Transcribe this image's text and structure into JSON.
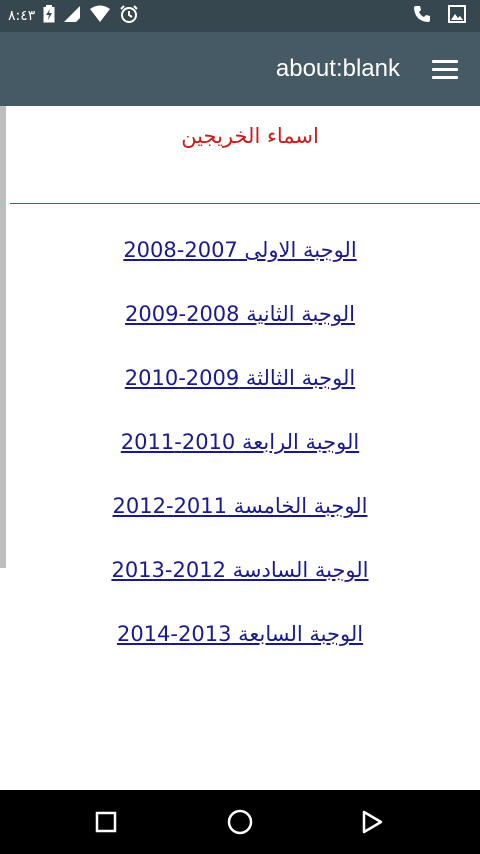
{
  "status_bar": {
    "time": "٨:٤٣",
    "icons": [
      "alarm-icon",
      "wifi-icon",
      "signal-icon",
      "battery-charging-icon",
      "phone-icon",
      "image-icon"
    ]
  },
  "toolbar": {
    "title": "about:blank",
    "menu_icon": "hamburger-menu-icon"
  },
  "page": {
    "heading": "اسماء الخريجين",
    "heading_color": "#cc1b1b",
    "link_color": "#1a1a8f",
    "links": [
      {
        "label": "الوجبة الاولى 2007-2008"
      },
      {
        "label": "الوجبة الثانية 2008-2009"
      },
      {
        "label": "الوجبة الثالثة 2009-2010"
      },
      {
        "label": "الوجبة الرابعة 2010-2011"
      },
      {
        "label": "الوجبة الخامسة 2011-2012"
      },
      {
        "label": "الوجبة السادسة 2012-2013"
      },
      {
        "label": "الوجبة السابعة 2013-2014"
      }
    ]
  },
  "nav_bar": {
    "buttons": [
      "recent-apps-icon",
      "home-icon",
      "back-icon"
    ]
  }
}
